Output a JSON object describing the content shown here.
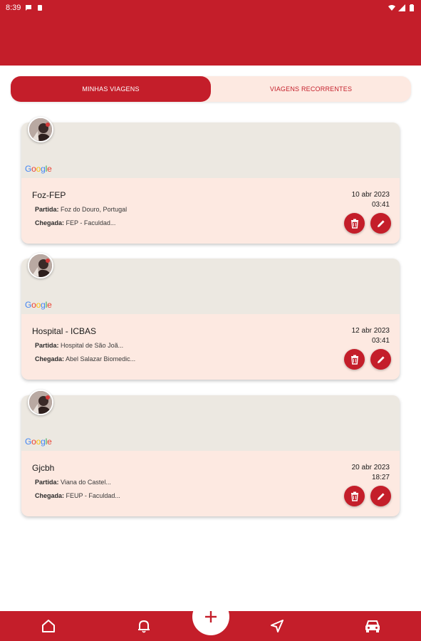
{
  "status_bar": {
    "time": "8:39"
  },
  "tabs": [
    {
      "label": "MINHAS VIAGENS",
      "active": true
    },
    {
      "label": "VIAGENS RECORRENTES",
      "active": false
    }
  ],
  "trips": [
    {
      "title": "Foz-FEP",
      "departure_label": "Partida:",
      "departure": "Foz do Douro, Portugal",
      "arrival_label": "Chegada:",
      "arrival": "FEP - Faculdad...",
      "date": "10 abr 2023",
      "time": "03:41"
    },
    {
      "title": "Hospital - ICBAS",
      "departure_label": "Partida:",
      "departure": "Hospital de São Joã...",
      "arrival_label": "Chegada:",
      "arrival": "Abel Salazar Biomedic...",
      "date": "12 abr 2023",
      "time": "03:41"
    },
    {
      "title": "Gjcbh",
      "departure_label": "Partida:",
      "departure": "Viana do Castel...",
      "arrival_label": "Chegada:",
      "arrival": "FEUP - Faculdad...",
      "date": "20 abr 2023",
      "time": "18:27"
    }
  ],
  "map_attribution": "Google",
  "icons": {
    "delete": "trash-icon",
    "edit": "pencil-icon",
    "nav": [
      "home-icon",
      "bell-icon",
      "plus-icon",
      "send-icon",
      "car-icon"
    ]
  },
  "colors": {
    "primary": "#c41e2a",
    "card_bg": "#fde9e1",
    "map_bg": "#ece8e1"
  }
}
